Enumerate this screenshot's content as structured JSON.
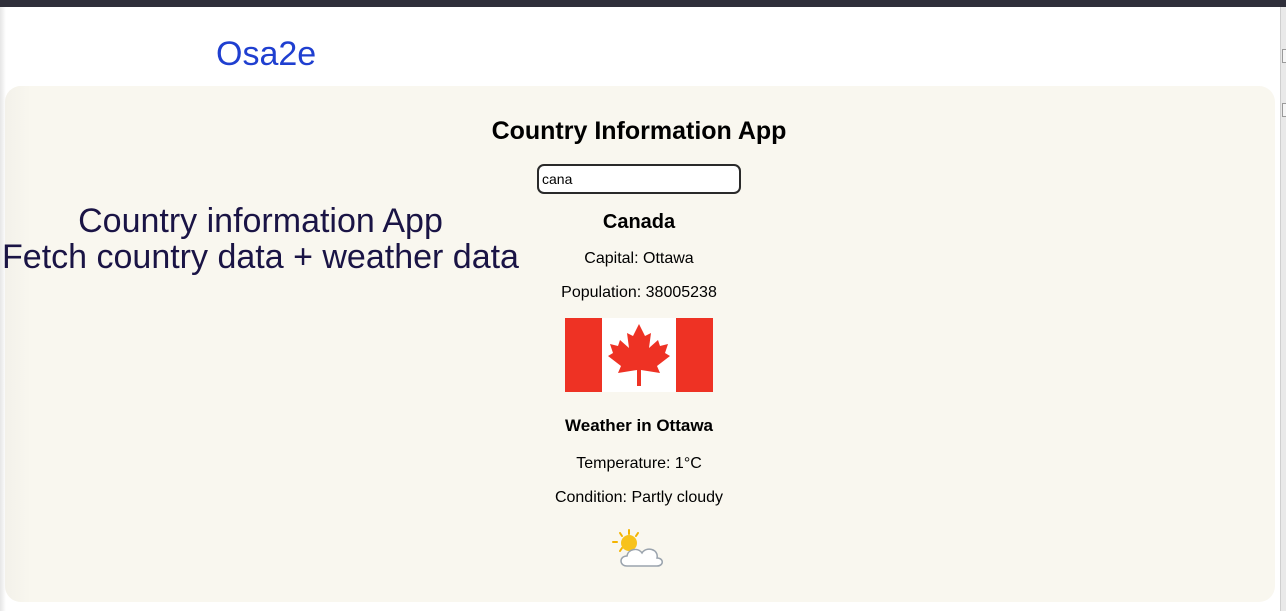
{
  "header": {
    "brand": "Osa2e"
  },
  "description": {
    "line1": "Country information App",
    "line2": "Fetch country data + weather data"
  },
  "app": {
    "title": "Country Information App",
    "search": {
      "value": "cana",
      "placeholder": ""
    },
    "country": {
      "name": "Canada",
      "capital": "Capital: Ottawa",
      "population": "Population: 38005238",
      "flag_icon": "canada-flag-icon",
      "flag_colors": {
        "red": "#ee3224",
        "white": "#ffffff"
      }
    },
    "weather": {
      "title": "Weather in Ottawa",
      "temperature": "Temperature: 1°C",
      "condition": "Condition: Partly cloudy",
      "icon": "partly-cloudy-icon"
    }
  },
  "colors": {
    "brand": "#1f3fd0",
    "panel_bg": "#f9f7ef",
    "description_text": "#1a1445"
  }
}
